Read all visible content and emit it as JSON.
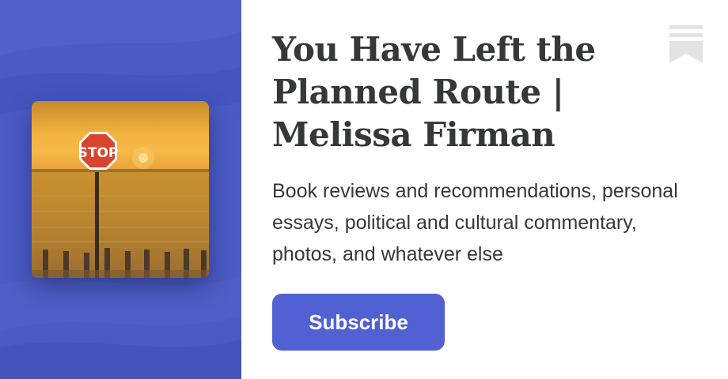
{
  "publication": {
    "title": "You Have Left the Planned Route | Melissa Firman",
    "description": "Book reviews and recommendations, personal essays, political and cultural commentary, photos, and whatever else",
    "cover_sign_text": "STOP"
  },
  "actions": {
    "subscribe_label": "Subscribe"
  },
  "icons": {
    "brand": "bookmark-icon"
  },
  "colors": {
    "panel": "#4a5bc4",
    "button": "#5160d3",
    "title_text": "#363737",
    "icon": "#e3e3e3"
  }
}
